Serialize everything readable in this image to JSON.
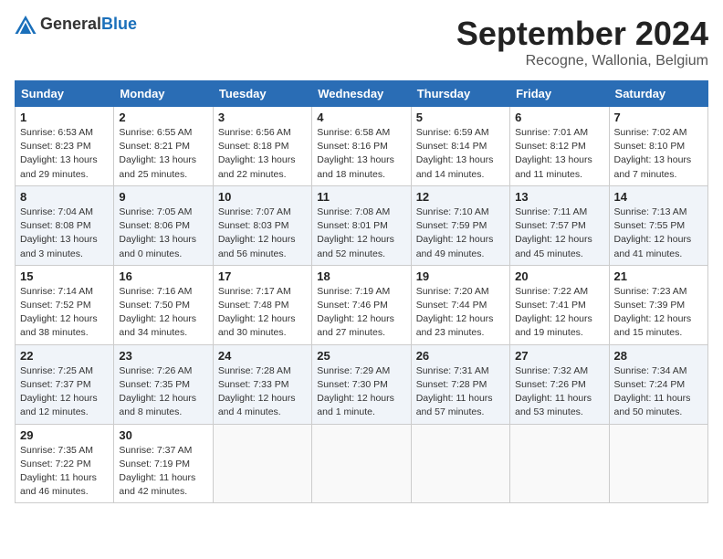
{
  "header": {
    "logo_general": "General",
    "logo_blue": "Blue",
    "month_title": "September 2024",
    "location": "Recogne, Wallonia, Belgium"
  },
  "days_of_week": [
    "Sunday",
    "Monday",
    "Tuesday",
    "Wednesday",
    "Thursday",
    "Friday",
    "Saturday"
  ],
  "weeks": [
    [
      {
        "day": "1",
        "detail": "Sunrise: 6:53 AM\nSunset: 8:23 PM\nDaylight: 13 hours\nand 29 minutes."
      },
      {
        "day": "2",
        "detail": "Sunrise: 6:55 AM\nSunset: 8:21 PM\nDaylight: 13 hours\nand 25 minutes."
      },
      {
        "day": "3",
        "detail": "Sunrise: 6:56 AM\nSunset: 8:18 PM\nDaylight: 13 hours\nand 22 minutes."
      },
      {
        "day": "4",
        "detail": "Sunrise: 6:58 AM\nSunset: 8:16 PM\nDaylight: 13 hours\nand 18 minutes."
      },
      {
        "day": "5",
        "detail": "Sunrise: 6:59 AM\nSunset: 8:14 PM\nDaylight: 13 hours\nand 14 minutes."
      },
      {
        "day": "6",
        "detail": "Sunrise: 7:01 AM\nSunset: 8:12 PM\nDaylight: 13 hours\nand 11 minutes."
      },
      {
        "day": "7",
        "detail": "Sunrise: 7:02 AM\nSunset: 8:10 PM\nDaylight: 13 hours\nand 7 minutes."
      }
    ],
    [
      {
        "day": "8",
        "detail": "Sunrise: 7:04 AM\nSunset: 8:08 PM\nDaylight: 13 hours\nand 3 minutes."
      },
      {
        "day": "9",
        "detail": "Sunrise: 7:05 AM\nSunset: 8:06 PM\nDaylight: 13 hours\nand 0 minutes."
      },
      {
        "day": "10",
        "detail": "Sunrise: 7:07 AM\nSunset: 8:03 PM\nDaylight: 12 hours\nand 56 minutes."
      },
      {
        "day": "11",
        "detail": "Sunrise: 7:08 AM\nSunset: 8:01 PM\nDaylight: 12 hours\nand 52 minutes."
      },
      {
        "day": "12",
        "detail": "Sunrise: 7:10 AM\nSunset: 7:59 PM\nDaylight: 12 hours\nand 49 minutes."
      },
      {
        "day": "13",
        "detail": "Sunrise: 7:11 AM\nSunset: 7:57 PM\nDaylight: 12 hours\nand 45 minutes."
      },
      {
        "day": "14",
        "detail": "Sunrise: 7:13 AM\nSunset: 7:55 PM\nDaylight: 12 hours\nand 41 minutes."
      }
    ],
    [
      {
        "day": "15",
        "detail": "Sunrise: 7:14 AM\nSunset: 7:52 PM\nDaylight: 12 hours\nand 38 minutes."
      },
      {
        "day": "16",
        "detail": "Sunrise: 7:16 AM\nSunset: 7:50 PM\nDaylight: 12 hours\nand 34 minutes."
      },
      {
        "day": "17",
        "detail": "Sunrise: 7:17 AM\nSunset: 7:48 PM\nDaylight: 12 hours\nand 30 minutes."
      },
      {
        "day": "18",
        "detail": "Sunrise: 7:19 AM\nSunset: 7:46 PM\nDaylight: 12 hours\nand 27 minutes."
      },
      {
        "day": "19",
        "detail": "Sunrise: 7:20 AM\nSunset: 7:44 PM\nDaylight: 12 hours\nand 23 minutes."
      },
      {
        "day": "20",
        "detail": "Sunrise: 7:22 AM\nSunset: 7:41 PM\nDaylight: 12 hours\nand 19 minutes."
      },
      {
        "day": "21",
        "detail": "Sunrise: 7:23 AM\nSunset: 7:39 PM\nDaylight: 12 hours\nand 15 minutes."
      }
    ],
    [
      {
        "day": "22",
        "detail": "Sunrise: 7:25 AM\nSunset: 7:37 PM\nDaylight: 12 hours\nand 12 minutes."
      },
      {
        "day": "23",
        "detail": "Sunrise: 7:26 AM\nSunset: 7:35 PM\nDaylight: 12 hours\nand 8 minutes."
      },
      {
        "day": "24",
        "detail": "Sunrise: 7:28 AM\nSunset: 7:33 PM\nDaylight: 12 hours\nand 4 minutes."
      },
      {
        "day": "25",
        "detail": "Sunrise: 7:29 AM\nSunset: 7:30 PM\nDaylight: 12 hours\nand 1 minute."
      },
      {
        "day": "26",
        "detail": "Sunrise: 7:31 AM\nSunset: 7:28 PM\nDaylight: 11 hours\nand 57 minutes."
      },
      {
        "day": "27",
        "detail": "Sunrise: 7:32 AM\nSunset: 7:26 PM\nDaylight: 11 hours\nand 53 minutes."
      },
      {
        "day": "28",
        "detail": "Sunrise: 7:34 AM\nSunset: 7:24 PM\nDaylight: 11 hours\nand 50 minutes."
      }
    ],
    [
      {
        "day": "29",
        "detail": "Sunrise: 7:35 AM\nSunset: 7:22 PM\nDaylight: 11 hours\nand 46 minutes."
      },
      {
        "day": "30",
        "detail": "Sunrise: 7:37 AM\nSunset: 7:19 PM\nDaylight: 11 hours\nand 42 minutes."
      },
      {
        "day": "",
        "detail": ""
      },
      {
        "day": "",
        "detail": ""
      },
      {
        "day": "",
        "detail": ""
      },
      {
        "day": "",
        "detail": ""
      },
      {
        "day": "",
        "detail": ""
      }
    ]
  ]
}
